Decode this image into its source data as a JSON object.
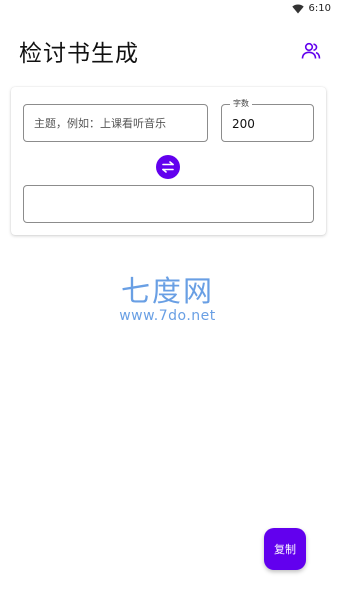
{
  "status_bar": {
    "time": "6:10"
  },
  "app_bar": {
    "title": "检讨书生成",
    "account_icon": "group-icon"
  },
  "form": {
    "topic_placeholder": "主题，例如：上课看听音乐",
    "topic_value": "",
    "count_label": "字数",
    "count_value": "200",
    "swap_icon": "swap-horizontal-icon",
    "output_value": ""
  },
  "watermark": {
    "logo": "七度网",
    "url": "www.7do.net"
  },
  "fab": {
    "copy_label": "复制"
  },
  "colors": {
    "accent": "#6200ee",
    "watermark": "#4f8fe0",
    "outline": "#8c8c8c"
  }
}
